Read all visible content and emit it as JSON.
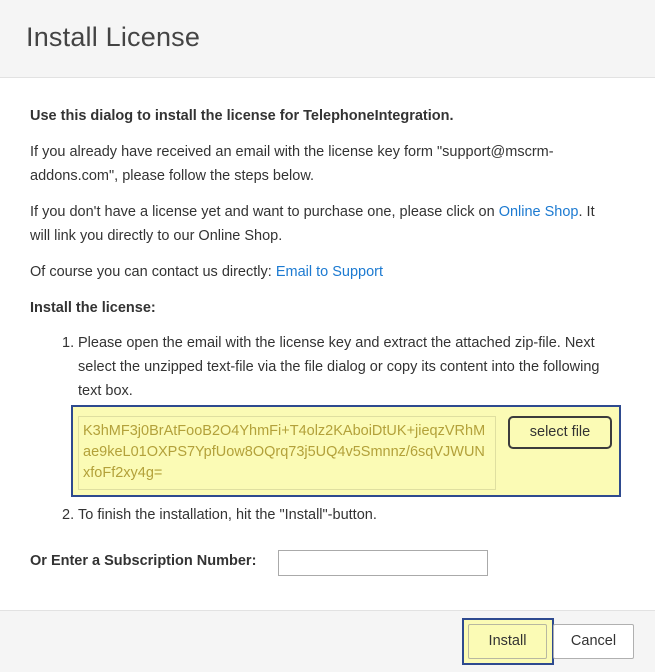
{
  "dialog": {
    "title": "Install License",
    "intro": "Use this dialog to install the license for TelephoneIntegration.",
    "para_email": "If you already have received an email with the license key form \"support@mscrm-addons.com\", please follow the steps below.",
    "para_purchase_prefix": "If you don't have a license yet and want to purchase one, please click on ",
    "online_shop_link": "Online Shop",
    "para_purchase_suffix": ". It will link you directly to our Online Shop.",
    "para_contact_prefix": "Of course you can contact us directly: ",
    "email_support_link": "Email to Support",
    "install_heading": "Install the license:",
    "step1_num": "1.",
    "step1_text": "Please open the email with the license key and extract the attached zip-file. Next select the unzipped text-file via the file dialog or copy its content into the following text box.",
    "license_key": "K3hMF3j0BrAtFooB2O4YhmFi+T4olz2KAboiDtUK+jieqzVRhMae9keL01OXPS7YpfUow8OQrq73j5UQ4v5Smnnz/6sqVJWUNxfoFf2xy4g=",
    "select_file_label": "select file",
    "step2_num": "2.",
    "step2_text": "To finish the installation, hit the \"Install\"-button.",
    "subscription_label": "Or Enter a Subscription Number:",
    "subscription_value": ""
  },
  "footer": {
    "install_label": "Install",
    "cancel_label": "Cancel"
  },
  "colors": {
    "highlight": "#fbfbb5",
    "highlight_border": "#2e4a8f",
    "link": "#1c7ad1"
  }
}
